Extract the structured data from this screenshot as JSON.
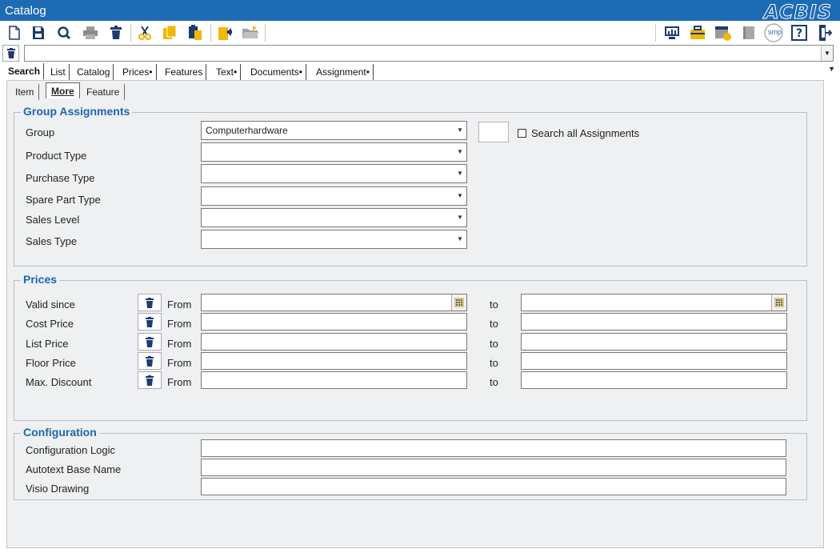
{
  "window": {
    "title": "Catalog",
    "brand": "ACBIS"
  },
  "toolbar": {
    "left_icons": [
      "new-document-icon",
      "save-icon",
      "search-icon",
      "print-icon",
      "delete-icon",
      "cut-icon",
      "copy-icon",
      "paste-icon",
      "import-icon",
      "open-folder-icon"
    ],
    "right_icons": [
      "monitor-chart-icon",
      "briefcase-icon",
      "calendar-approve-icon",
      "book-icon",
      "smp-icon",
      "help-icon",
      "exit-icon"
    ],
    "smp_label": "smp"
  },
  "filter": {
    "value": ""
  },
  "tabs": [
    "Search",
    "List",
    "Catalog",
    "Prices•",
    "Features",
    "Text•",
    "Documents•",
    "Assignment•"
  ],
  "subtabs": [
    "Item",
    "More",
    "Feature"
  ],
  "group_assignments": {
    "title": "Group Assignments",
    "group_label": "Group",
    "group_value": "Computerhardware",
    "product_type_label": "Product Type",
    "purchase_type_label": "Purchase Type",
    "spare_part_type_label": "Spare Part Type",
    "sales_level_label": "Sales Level",
    "sales_type_label": "Sales Type",
    "search_all_label": "Search all Assignments"
  },
  "prices": {
    "title": "Prices",
    "from_label": "From",
    "to_label": "to",
    "rows": [
      "Valid since",
      "Cost Price",
      "List Price",
      "Floor Price",
      "Max. Discount"
    ]
  },
  "configuration": {
    "title": "Configuration",
    "rows": [
      "Configuration Logic",
      "Autotext Base Name",
      "Visio Drawing"
    ]
  },
  "colors": {
    "title_bar": "#1d6bb4",
    "accent": "#1e66ad",
    "icon_yellow": "#f2b705",
    "panel_bg": "#eef0f1"
  }
}
